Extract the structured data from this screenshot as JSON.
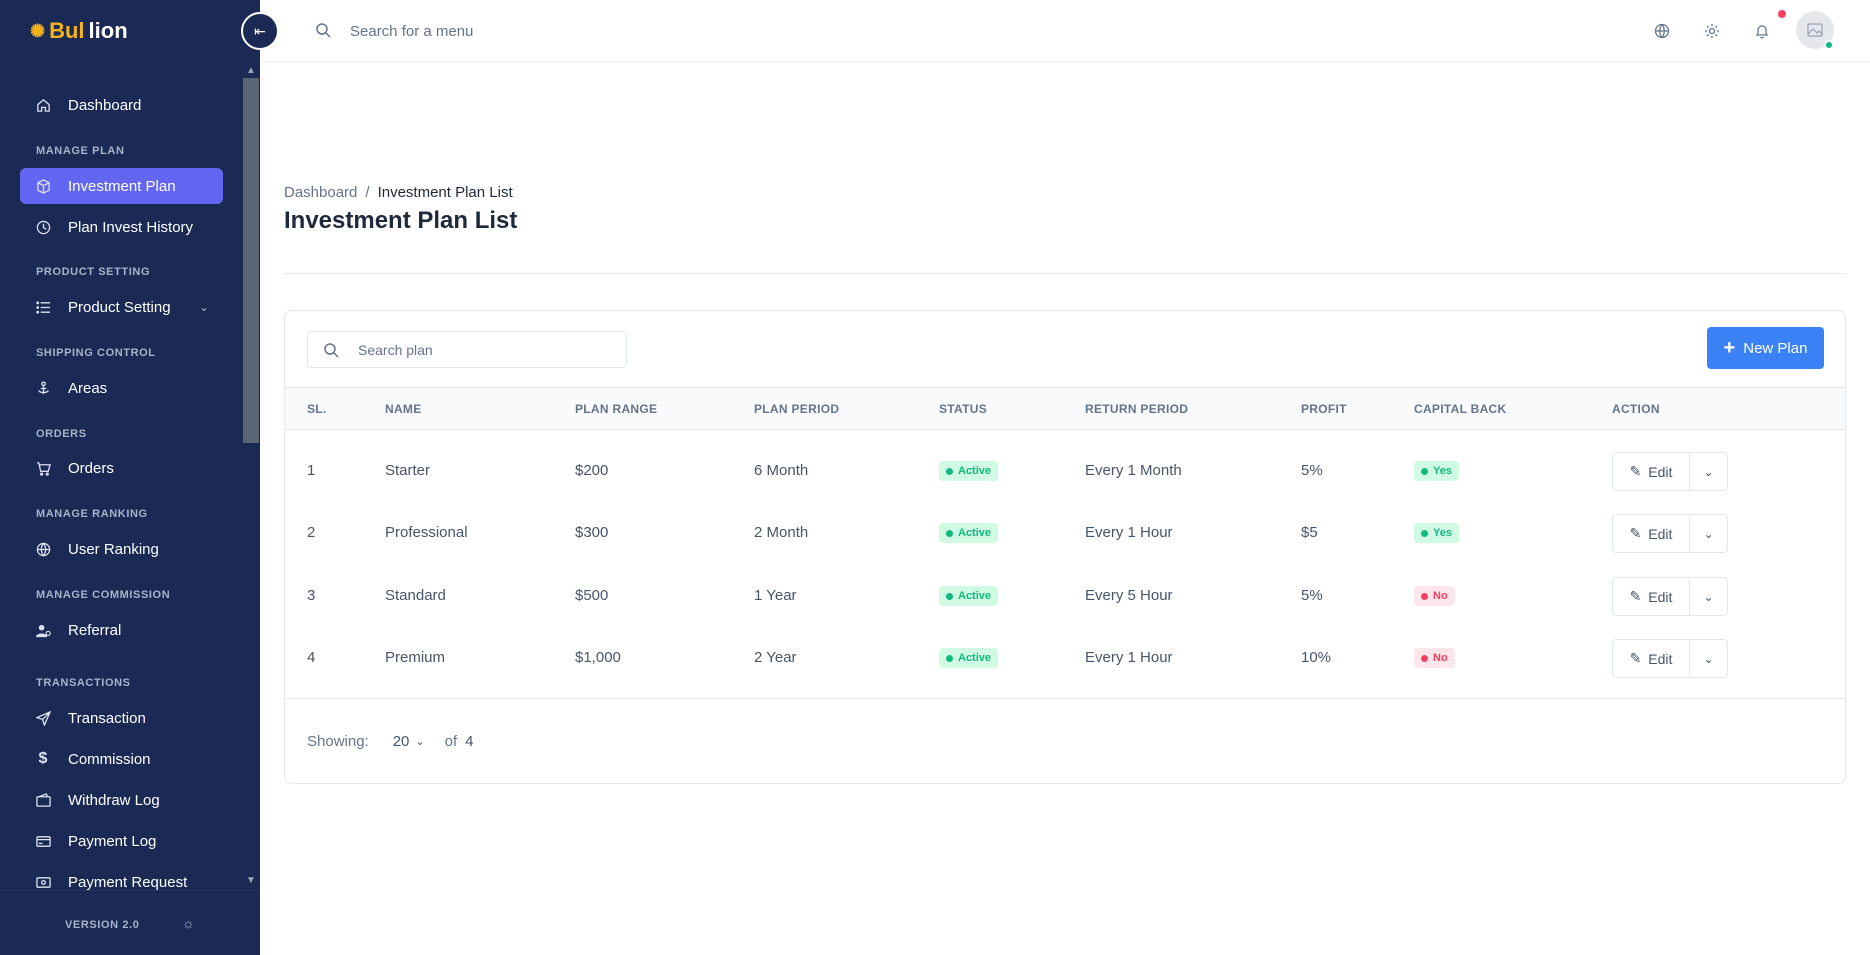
{
  "brand": {
    "part1": "Bul",
    "part2": "lion"
  },
  "sidebar": {
    "items": [
      {
        "label": "Dashboard"
      },
      {
        "label": "Investment Plan"
      },
      {
        "label": "Plan Invest History"
      },
      {
        "label": "Product Setting"
      },
      {
        "label": "Areas"
      },
      {
        "label": "Orders"
      },
      {
        "label": "User Ranking"
      },
      {
        "label": "Referral"
      },
      {
        "label": "Transaction"
      },
      {
        "label": "Commission"
      },
      {
        "label": "Withdraw Log"
      },
      {
        "label": "Payment Log"
      },
      {
        "label": "Payment Request"
      }
    ],
    "sections": [
      "MANAGE PLAN",
      "PRODUCT SETTING",
      "SHIPPING CONTROL",
      "ORDERS",
      "MANAGE RANKING",
      "MANAGE COMMISSION",
      "TRANSACTIONS"
    ],
    "version": "VERSION 2.0"
  },
  "header": {
    "search_placeholder": "Search for a menu"
  },
  "breadcrumb": {
    "root": "Dashboard",
    "separator": "/",
    "current": "Investment Plan List"
  },
  "page_title": "Investment Plan List",
  "toolbar": {
    "search_placeholder": "Search plan",
    "new_plan_label": "New Plan"
  },
  "table": {
    "headers": [
      "SL.",
      "NAME",
      "PLAN RANGE",
      "PLAN PERIOD",
      "STATUS",
      "RETURN PERIOD",
      "PROFIT",
      "CAPITAL BACK",
      "ACTION"
    ],
    "rows": [
      {
        "sl": "1",
        "name": "Starter",
        "range": "$200",
        "period": "6 Month",
        "status": "Active",
        "return": "Every 1 Month",
        "profit": "5%",
        "capital": "Yes"
      },
      {
        "sl": "2",
        "name": "Professional",
        "range": "$300",
        "period": "2 Month",
        "status": "Active",
        "return": "Every 1 Hour",
        "profit": "$5",
        "capital": "Yes"
      },
      {
        "sl": "3",
        "name": "Standard",
        "range": "$500",
        "period": "1 Year",
        "status": "Active",
        "return": "Every 5 Hour",
        "profit": "5%",
        "capital": "No"
      },
      {
        "sl": "4",
        "name": "Premium",
        "range": "$1,000",
        "period": "2 Year",
        "status": "Active",
        "return": "Every 1 Hour",
        "profit": "10%",
        "capital": "No"
      }
    ],
    "edit_label": "Edit"
  },
  "pagination": {
    "showing_label": "Showing:",
    "page_size": "20",
    "of_label": "of",
    "total": "4"
  },
  "colors": {
    "sidebar_bg": "#1a2a55",
    "accent": "#6366f1",
    "primary": "#3b82f6",
    "success": "#10b981",
    "danger": "#f43f5e",
    "brand_gold": "#f5b21b"
  }
}
